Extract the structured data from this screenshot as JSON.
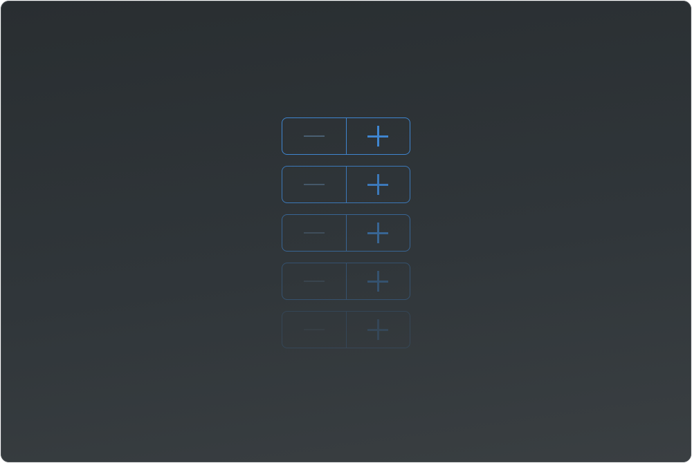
{
  "app": {
    "accent_color": "#3f86d1",
    "background_color": "#2d3235"
  },
  "steppers": [
    {
      "decrement_icon": "minus-icon",
      "increment_icon": "plus-icon",
      "emphasis": 1.0
    },
    {
      "decrement_icon": "minus-icon",
      "increment_icon": "plus-icon",
      "emphasis": 0.85
    },
    {
      "decrement_icon": "minus-icon",
      "increment_icon": "plus-icon",
      "emphasis": 0.6
    },
    {
      "decrement_icon": "minus-icon",
      "increment_icon": "plus-icon",
      "emphasis": 0.35
    },
    {
      "decrement_icon": "minus-icon",
      "increment_icon": "plus-icon",
      "emphasis": 0.18
    }
  ]
}
